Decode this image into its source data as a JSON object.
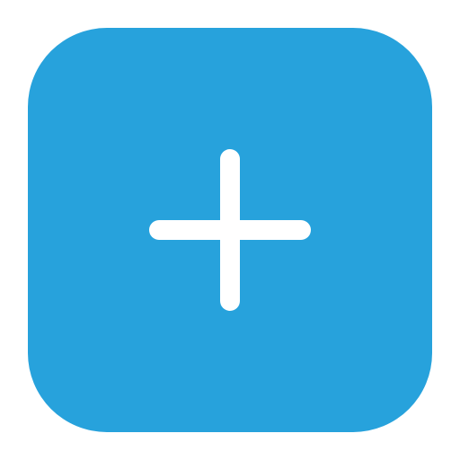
{
  "icon": {
    "name": "plus-icon",
    "accent_color": "#27a2dc",
    "glyph_color": "#ffffff",
    "background_color": "#ffffff"
  }
}
